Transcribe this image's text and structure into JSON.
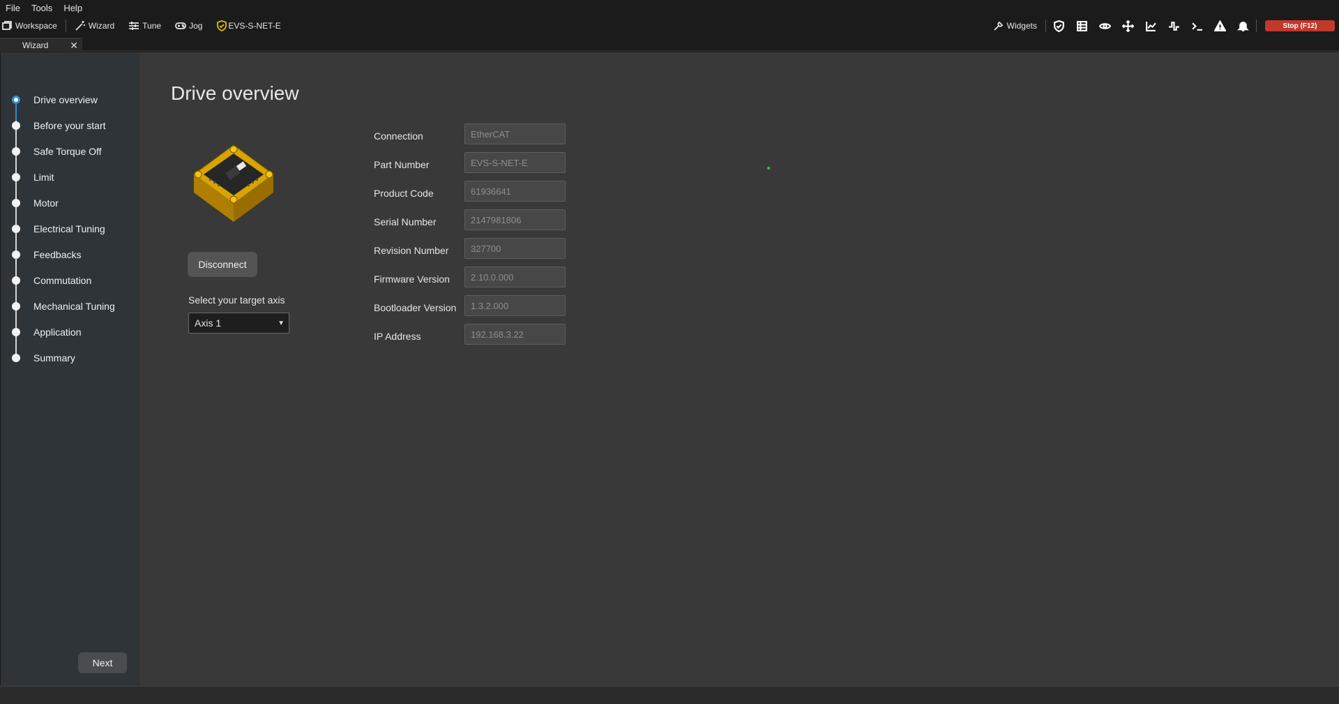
{
  "menu": {
    "items": [
      "File",
      "Tools",
      "Help"
    ]
  },
  "toolbar": {
    "workspace": "Workspace",
    "wizard": "Wizard",
    "tune": "Tune",
    "jog": "Jog",
    "device": "EVS-S-NET-E",
    "widgets": "Widgets",
    "stop": "Stop (F12)",
    "stop_color": "#c0392b",
    "right_icons": [
      "shield-check-icon",
      "table-icon",
      "eye-icon",
      "move-icon",
      "chart-icon",
      "pulse-icon",
      "terminal-icon",
      "warning-icon",
      "bell-icon"
    ]
  },
  "tabs": [
    {
      "label": "Wizard",
      "close": "✕"
    }
  ],
  "sidebar": {
    "steps": [
      {
        "label": "Drive overview",
        "active": true
      },
      {
        "label": "Before your start",
        "active": false
      },
      {
        "label": "Safe Torque Off",
        "active": false
      },
      {
        "label": "Limit",
        "active": false
      },
      {
        "label": "Motor",
        "active": false
      },
      {
        "label": "Electrical Tuning",
        "active": false
      },
      {
        "label": "Feedbacks",
        "active": false
      },
      {
        "label": "Commutation",
        "active": false
      },
      {
        "label": "Mechanical Tuning",
        "active": false
      },
      {
        "label": "Application",
        "active": false
      },
      {
        "label": "Summary",
        "active": false
      }
    ],
    "next": "Next",
    "accent": "#2d8fd5"
  },
  "main": {
    "title": "Drive overview",
    "disconnect": "Disconnect",
    "axis_label": "Select your target axis",
    "axis_value": "Axis 1",
    "info": [
      {
        "label": "Connection",
        "value": "EtherCAT"
      },
      {
        "label": "Part Number",
        "value": "EVS-S-NET-E"
      },
      {
        "label": "Product Code",
        "value": "61936641"
      },
      {
        "label": "Serial Number",
        "value": "2147981806"
      },
      {
        "label": "Revision Number",
        "value": "327700"
      },
      {
        "label": "Firmware Version",
        "value": "2.10.0.000"
      },
      {
        "label": "Bootloader Version",
        "value": "1.3.2.000"
      },
      {
        "label": "IP Address",
        "value": "192.168.3.22"
      }
    ]
  }
}
